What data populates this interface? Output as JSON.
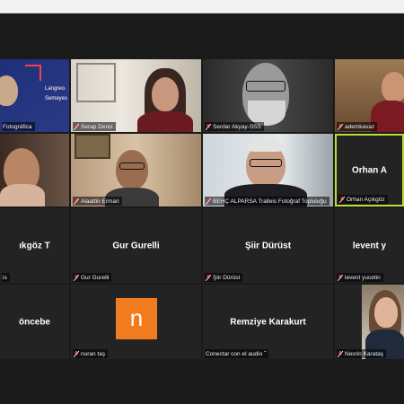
{
  "tiles": [
    {
      "name": "Fotográfica",
      "big": ""
    },
    {
      "name": "Serap Deniz",
      "big": ""
    },
    {
      "name": "Serdar Akyay-SSS",
      "big": ""
    },
    {
      "name": "ademkavaz",
      "big": ""
    },
    {
      "name": "",
      "big": ""
    },
    {
      "name": "Alaattin Erman",
      "big": ""
    },
    {
      "name": "BEHÇ ALPARSA   Tralleis Fotoğraf Topluluğu",
      "big": ""
    },
    {
      "name": "Orhan Açıkgöz",
      "big": "Orhan A"
    },
    {
      "name": "is",
      "big": "ıkgöz  T"
    },
    {
      "name": "Gur Gurelli",
      "big": "Gur Gurelli"
    },
    {
      "name": "Şiir Dürüst",
      "big": "Şiir Dürüst"
    },
    {
      "name": "levent yucetin",
      "big": "levent y"
    },
    {
      "name": "",
      "big": "öncebe"
    },
    {
      "name": "nuran taş",
      "big": ""
    },
    {
      "name": "Conectar con el audio",
      "big": "Remziye Karakurt"
    },
    {
      "name": "Nesrin Karataş",
      "big": ""
    }
  ],
  "logo": {
    "line1": "Langreo.",
    "line2": "Semeyes"
  },
  "avatar_initial": "n",
  "colors": {
    "active_border": "#b9dc3b",
    "avatar_bg": "#f07c1f",
    "muted_mic": "#e0302f"
  }
}
